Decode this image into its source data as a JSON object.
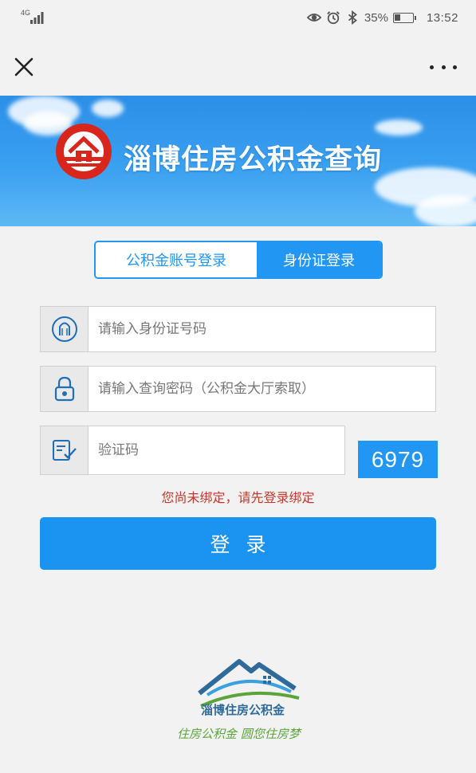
{
  "status_bar": {
    "network": "4G",
    "battery_percent": "35%",
    "battery_level": 0.35,
    "time": "13:52",
    "icons": [
      "signal-icon",
      "eye-icon",
      "alarm-icon",
      "bluetooth-icon",
      "battery-icon"
    ]
  },
  "nav": {
    "close_icon": "close-icon",
    "more_icon": "more-icon"
  },
  "banner": {
    "title": "淄博住房公积金查询",
    "logo_icon": "house-emblem-icon"
  },
  "tabs": [
    {
      "label": "公积金账号登录",
      "active": false
    },
    {
      "label": "身份证登录",
      "active": true
    }
  ],
  "form": {
    "id_field": {
      "placeholder": "请输入身份证号码",
      "value": "",
      "icon": "person-icon"
    },
    "password_field": {
      "placeholder": "请输入查询密码（公积金大厅索取）",
      "value": "",
      "icon": "lock-icon"
    },
    "captcha_field": {
      "placeholder": "验证码",
      "value": "",
      "icon": "edit-check-icon"
    },
    "captcha_code": "6979",
    "error": "您尚未绑定，请先登录绑定",
    "login_label": "登录"
  },
  "footer": {
    "brand": "淄博住房公积金",
    "slogan": "住房公积金  圆您住房梦"
  },
  "colors": {
    "accent": "#2196f3",
    "error": "#c0392b",
    "slogan": "#5aa43a",
    "emblem": "#d9261c"
  }
}
